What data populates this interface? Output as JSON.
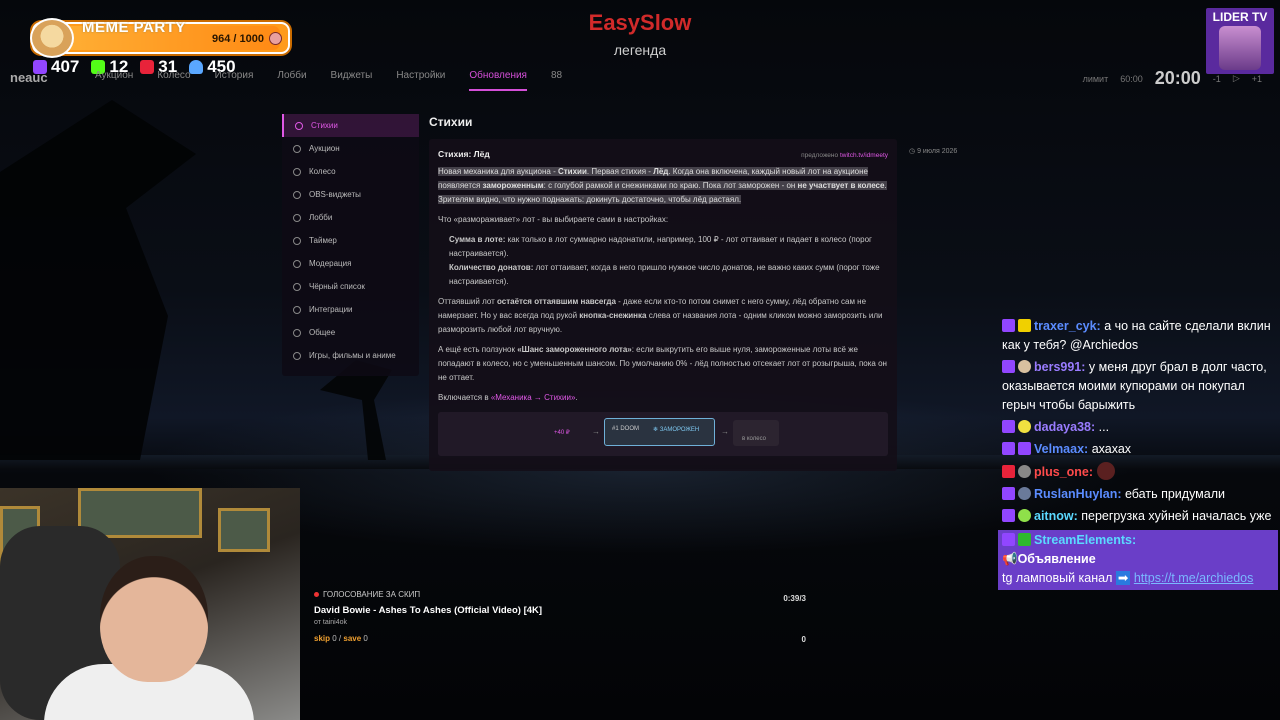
{
  "overlay": {
    "meme_party": {
      "title": "MEME PARTY",
      "score": "964 / 1000"
    },
    "stats": [
      {
        "icon": "twitch-icon",
        "value": "407",
        "color": "#9146ff"
      },
      {
        "icon": "kick-icon",
        "value": "12",
        "color": "#53fc18"
      },
      {
        "icon": "live-icon",
        "value": "31",
        "color": "#e8233a"
      },
      {
        "icon": "viewers-icon",
        "value": "450",
        "color": "#5aa7ff"
      }
    ],
    "streamer_name": "EasySlow",
    "streamer_subtitle": "легенда",
    "lider_label": "LIDER TV"
  },
  "app": {
    "logo": "neauc",
    "nav": [
      {
        "label": "Аукцион",
        "icon": "auction-icon"
      },
      {
        "label": "Колесо",
        "icon": "wheel-icon"
      },
      {
        "label": "История",
        "icon": "history-icon"
      },
      {
        "label": "Лобби",
        "icon": "lobby-icon"
      },
      {
        "label": "Виджеты",
        "icon": "widgets-icon"
      },
      {
        "label": "Настройки",
        "icon": "settings-icon"
      },
      {
        "label": "Обновления",
        "icon": "updates-icon"
      }
    ],
    "nav_extra": "88",
    "limit_label": "лимит",
    "limit_value": "60:00",
    "timer": "20:00",
    "minus": "-1",
    "plus": "+1"
  },
  "sidebar": [
    "Стихии",
    "Аукцион",
    "Колесо",
    "OBS-виджеты",
    "Лобби",
    "Таймер",
    "Модерация",
    "Чёрный список",
    "Интеграции",
    "Общее",
    "Игры, фильмы и аниме"
  ],
  "update": {
    "section_title": "Стихии",
    "card_title": "Стихия: Лёд",
    "suggested_prefix": "предложено",
    "suggested_link": "twitch.tv/idmeety",
    "date": "9 июля 2026",
    "intro_a": "Новая механика для аукциона - ",
    "intro_b": "Стихии",
    "intro_c": ". Первая стихия - ",
    "intro_d": "Лёд",
    "intro_e": ". Когда она включена, каждый новый лот на аукционе появляется ",
    "intro_f": "замороженным",
    "intro_g": ": с голубой рамкой и снежинками по краю. Пока лот заморожен - он ",
    "intro_h": "не участвует в колесе",
    "intro_i": ". Зрителям видно, что нужно поднажать: докинуть достаточно, чтобы лёд растаял.",
    "what_thaws": "Что «размораживает» лот - вы выбираете сами в настройках:",
    "opt1_b": "Сумма в лоте:",
    "opt1_t": " как только в лот суммарно надонатили, например, 100 ₽ - лот оттаивает и падает в колесо (порог настраивается).",
    "opt2_b": "Количество донатов:",
    "opt2_t": " лот оттаивает, когда в него пришло нужное число донатов, не важно каких сумм (порог тоже настраивается).",
    "p3_a": "Оттаявший лот ",
    "p3_b": "остаётся оттаявшим навсегда",
    "p3_c": " - даже если кто-то потом снимет с него сумму, лёд обратно сам не намерзает. Но у вас всегда под рукой ",
    "p3_d": "кнопка-снежинка",
    "p3_e": " слева от названия лота - одним кликом можно заморозить или разморозить любой лот вручную.",
    "p4_a": "А ещё есть ползунок ",
    "p4_b": "«Шанс замороженного лота»",
    "p4_c": ": если выкрутить его выше нуля, замороженные лоты всё же попадают в колесо, но с уменьшенным шансом. По умолчанию 0% - лёд полностью отсекает лот от розыгрыша, пока он не оттает.",
    "p5_a": "Включается в ",
    "p5_b": "«Механика → Стихии»",
    "p5_c": ".",
    "demo_donate": "+40 ₽",
    "demo_lot": "#1 DOOM",
    "demo_frozen": "❄ ЗАМОРОЖЕН",
    "demo_wheel": "в колесо"
  },
  "now_playing": {
    "vote_label": "ГОЛОСОВАНИЕ ЗА СКИП",
    "song": "David Bowie - Ashes To Ashes (Official Video) [4K]",
    "from": "от taini4ok",
    "skip_label": "skip",
    "skip_value": "0",
    "save_label": "save",
    "save_value": "0",
    "time": "0:39/3",
    "count": "0"
  },
  "chat": [
    {
      "user": "traxer_cyk:",
      "color": "#5b8cff",
      "text": "а чо на сайте сделали вклин как у тебя? @Archiedos"
    },
    {
      "user": "bers991:",
      "color": "#9a7cff",
      "text": "у меня друг брал в долг часто, оказывается моими купюрами он покупал герыч чтобы барыжить"
    },
    {
      "user": "dadaya38:",
      "color": "#9a7cff",
      "text": "..."
    },
    {
      "user": "Velmaax:",
      "color": "#5b8cff",
      "text": "ахахах"
    },
    {
      "user": "plus_one:",
      "color": "#ff4b4b",
      "text": ""
    },
    {
      "user": "RuslanHuylan:",
      "color": "#5b8cff",
      "text": "ебать придумали"
    },
    {
      "user": "aitnow:",
      "color": "#5bd9ff",
      "text": "перегрузка хуйней началась уже"
    },
    {
      "user": "StreamElements:",
      "color": "#5bd9ff",
      "announcement": "Объявление",
      "text": "tg ламповый канал",
      "link": "https://t.me/archiedos"
    }
  ]
}
